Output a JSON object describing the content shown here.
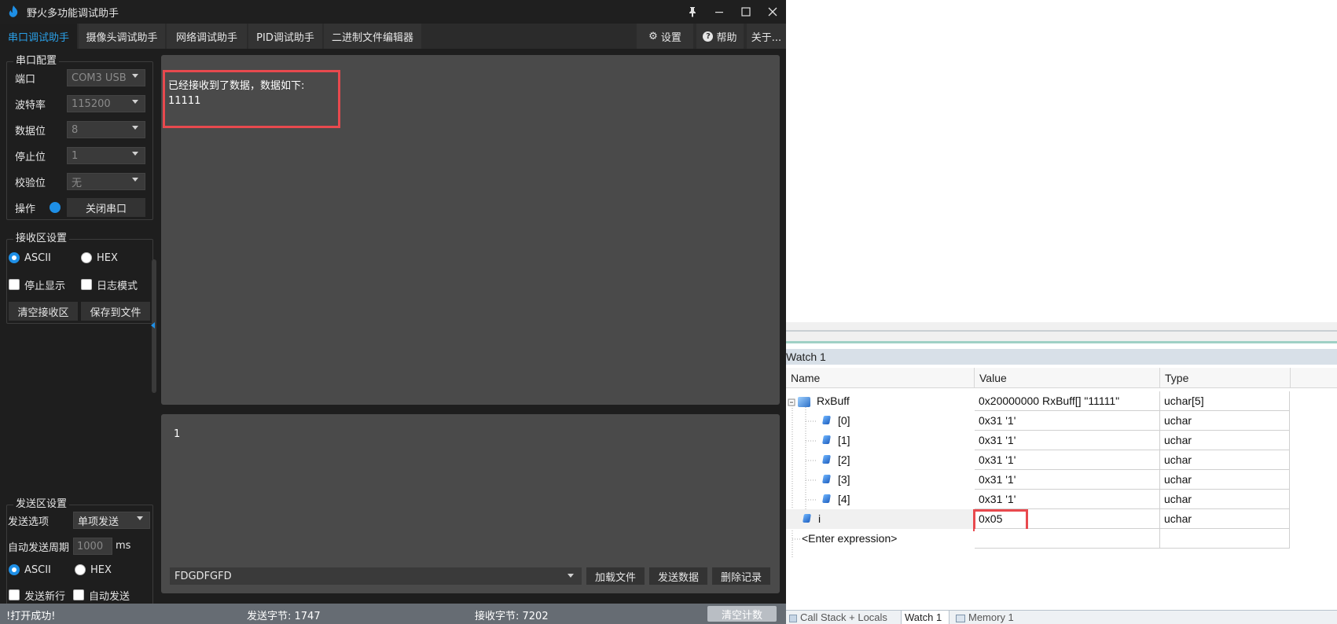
{
  "window": {
    "title": "野火多功能调试助手",
    "controls": [
      "pin",
      "minimize",
      "maximize",
      "close"
    ]
  },
  "tabs": [
    "串口调试助手",
    "摄像头调试助手",
    "网络调试助手",
    "PID调试助手",
    "二进制文件编辑器"
  ],
  "toolbar": {
    "settings": "设置",
    "help": "帮助",
    "about": "关于..."
  },
  "serial_config": {
    "legend": "串口配置",
    "port_label": "端口",
    "port_value": "COM3 USB",
    "baud_label": "波特率",
    "baud_value": "115200",
    "databits_label": "数据位",
    "databits_value": "8",
    "stopbits_label": "停止位",
    "stopbits_value": "1",
    "parity_label": "校验位",
    "parity_value": "无",
    "op_label": "操作",
    "close_port_button": "关闭串口"
  },
  "recv_settings": {
    "legend": "接收区设置",
    "ascii": "ASCII",
    "hex": "HEX",
    "stop_display": "停止显示",
    "log_mode": "日志模式",
    "clear_button": "清空接收区",
    "save_button": "保存到文件"
  },
  "recv_area": {
    "line1": "已经接收到了数据，数据如下:",
    "line2": "11111"
  },
  "send_settings": {
    "legend": "发送区设置",
    "option_label": "发送选项",
    "option_value": "单项发送",
    "period_label": "自动发送周期",
    "period_value": "1000",
    "period_unit": "ms",
    "ascii": "ASCII",
    "hex": "HEX",
    "newline": "发送新行",
    "auto_send": "自动发送"
  },
  "send_area": {
    "text": "1",
    "combo_value": "FDGDFGFD",
    "load_file": "加载文件",
    "send_data": "发送数据",
    "delete_history": "删除记录"
  },
  "status": {
    "message": "!打开成功!",
    "sent": "发送字节: 1747",
    "received": "接收字节: 7202",
    "clear_count": "清空计数"
  },
  "watch": {
    "title": "Watch 1",
    "columns": [
      "Name",
      "Value",
      "Type"
    ],
    "rows": [
      {
        "name": "RxBuff",
        "value": "0x20000000 RxBuff[] \"11111\"",
        "type": "uchar[5]"
      },
      {
        "name": "[0]",
        "value": "0x31 '1'",
        "type": "uchar"
      },
      {
        "name": "[1]",
        "value": "0x31 '1'",
        "type": "uchar"
      },
      {
        "name": "[2]",
        "value": "0x31 '1'",
        "type": "uchar"
      },
      {
        "name": "[3]",
        "value": "0x31 '1'",
        "type": "uchar"
      },
      {
        "name": "[4]",
        "value": "0x31 '1'",
        "type": "uchar"
      },
      {
        "name": "i",
        "value": "0x05",
        "type": "uchar"
      },
      {
        "name": "<Enter expression>",
        "value": "",
        "type": ""
      }
    ],
    "bottom_tabs": [
      "Call Stack + Locals",
      "Watch 1",
      "Memory 1"
    ]
  },
  "colors": {
    "accent": "#2a9fe6",
    "highlight": "#e8494e",
    "panel": "#4a4a4a",
    "status": "#666c73"
  }
}
